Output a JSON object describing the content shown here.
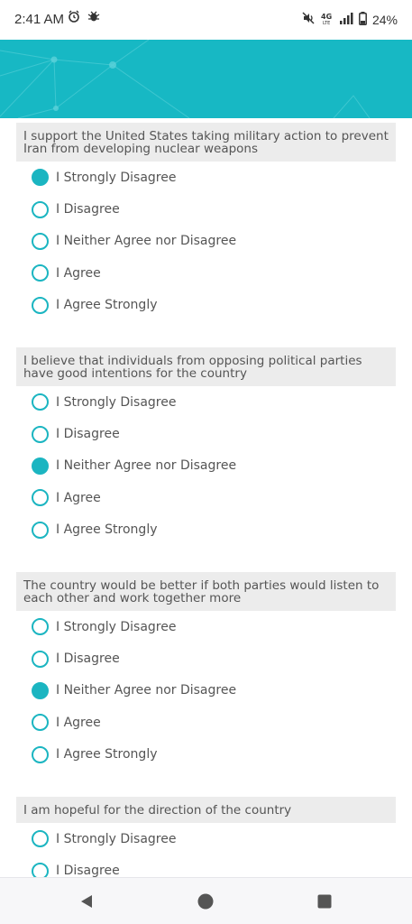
{
  "status": {
    "time": "2:41 AM",
    "battery": "24%",
    "icons_left": [
      "alarm-icon",
      "bug-icon"
    ],
    "icons_right": [
      "mute-icon",
      "4g-lte-icon",
      "signal-icon",
      "battery-icon"
    ]
  },
  "colors": {
    "accent": "#17b8c4",
    "question_bg": "#ececec"
  },
  "questions": [
    {
      "text": "I support the United States taking military action to prevent Iran from developing nuclear weapons",
      "options": [
        "I Strongly Disagree",
        "I Disagree",
        "I Neither Agree nor Disagree",
        "I Agree",
        "I Agree Strongly"
      ],
      "selected": 0
    },
    {
      "text": "I believe that individuals from opposing political parties have good intentions for the country",
      "options": [
        "I Strongly Disagree",
        "I Disagree",
        "I Neither Agree nor Disagree",
        "I Agree",
        "I Agree Strongly"
      ],
      "selected": 2
    },
    {
      "text": "The country would be better if both parties would listen to each other and work together more",
      "options": [
        "I Strongly Disagree",
        "I Disagree",
        "I Neither Agree nor Disagree",
        "I Agree",
        "I Agree Strongly"
      ],
      "selected": 2
    },
    {
      "text": "I am hopeful for the direction of the country",
      "options": [
        "I Strongly Disagree",
        "I Disagree"
      ],
      "selected": null
    }
  ],
  "nav": {
    "icons": [
      "back-icon",
      "home-icon",
      "recents-icon"
    ]
  }
}
